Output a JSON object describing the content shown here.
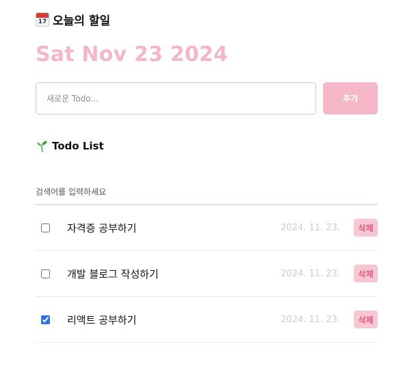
{
  "header": {
    "title": "오늘의 할일",
    "calendar_icon": "calendar-icon",
    "calendar_day": "17",
    "date": "Sat Nov 23 2024"
  },
  "editor": {
    "placeholder": "새로운 Todo...",
    "value": "",
    "add_label": "추가"
  },
  "list": {
    "title": "Todo List",
    "title_icon": "sprout-icon",
    "search_placeholder": "검색어를 입력하세요",
    "items": [
      {
        "content": "자격증 공부하기",
        "date": "2024. 11. 23.",
        "done": false,
        "delete_label": "삭제"
      },
      {
        "content": "개발 블로그 작성하기",
        "date": "2024. 11. 23.",
        "done": false,
        "delete_label": "삭제"
      },
      {
        "content": "리액트 공부하기",
        "date": "2024. 11. 23.",
        "done": true,
        "delete_label": "삭제"
      }
    ]
  },
  "colors": {
    "accent_pink": "#f2b8c8",
    "button_pink": "#f4b8c8",
    "delete_bg": "#f7c7d3",
    "delete_text": "#e05a7e",
    "date_gray": "#cccccc",
    "checkbox_blue": "#2f6fe0"
  }
}
